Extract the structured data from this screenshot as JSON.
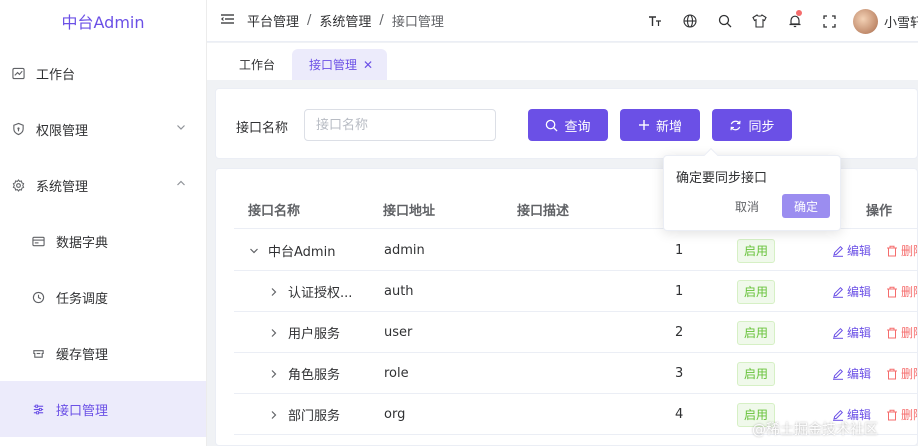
{
  "sidebar": {
    "logo": "中台Admin",
    "items": [
      {
        "label": "工作台",
        "icon": "dashboard-icon"
      },
      {
        "label": "权限管理",
        "icon": "shield-icon",
        "expanded": false
      },
      {
        "label": "系统管理",
        "icon": "gear-icon",
        "expanded": true
      },
      {
        "label": "数据字典",
        "icon": "dictionary-icon"
      },
      {
        "label": "任务调度",
        "icon": "clock-icon"
      },
      {
        "label": "缓存管理",
        "icon": "cache-icon"
      },
      {
        "label": "接口管理",
        "icon": "sliders-icon",
        "active": true
      }
    ]
  },
  "header": {
    "breadcrumb": [
      "平台管理",
      "系统管理",
      "接口管理"
    ],
    "icons": [
      "font-size-icon",
      "globe-icon",
      "search-icon",
      "tshirt-icon",
      "bell-icon",
      "fullscreen-icon"
    ],
    "username": "小雪轩"
  },
  "tabs": [
    {
      "label": "工作台",
      "active": false
    },
    {
      "label": "接口管理",
      "active": true,
      "closable": true
    }
  ],
  "search": {
    "label": "接口名称",
    "placeholder": "接口名称",
    "value": "",
    "query_label": "查询",
    "add_label": "新增",
    "sync_label": "同步"
  },
  "popconfirm": {
    "message": "确定要同步接口",
    "cancel": "取消",
    "confirm": "确定"
  },
  "table": {
    "columns": [
      "接口名称",
      "接口地址",
      "接口描述",
      "操作"
    ],
    "rows": [
      {
        "name": "中台Admin",
        "address": "admin",
        "desc": "",
        "sort": "1",
        "status": "启用",
        "expanded": true
      },
      {
        "name": "认证授权...",
        "address": "auth",
        "desc": "",
        "sort": "1",
        "status": "启用",
        "expanded": false
      },
      {
        "name": "用户服务",
        "address": "user",
        "desc": "",
        "sort": "2",
        "status": "启用",
        "expanded": false
      },
      {
        "name": "角色服务",
        "address": "role",
        "desc": "",
        "sort": "3",
        "status": "启用",
        "expanded": false
      },
      {
        "name": "部门服务",
        "address": "org",
        "desc": "",
        "sort": "4",
        "status": "启用",
        "expanded": false
      }
    ],
    "edit_label": "编辑",
    "delete_label": "删除"
  },
  "watermark": "@稀土掘金技术社区",
  "colors": {
    "primary": "#6b50e6",
    "success": "#67c23a",
    "danger": "#f56c6c"
  }
}
